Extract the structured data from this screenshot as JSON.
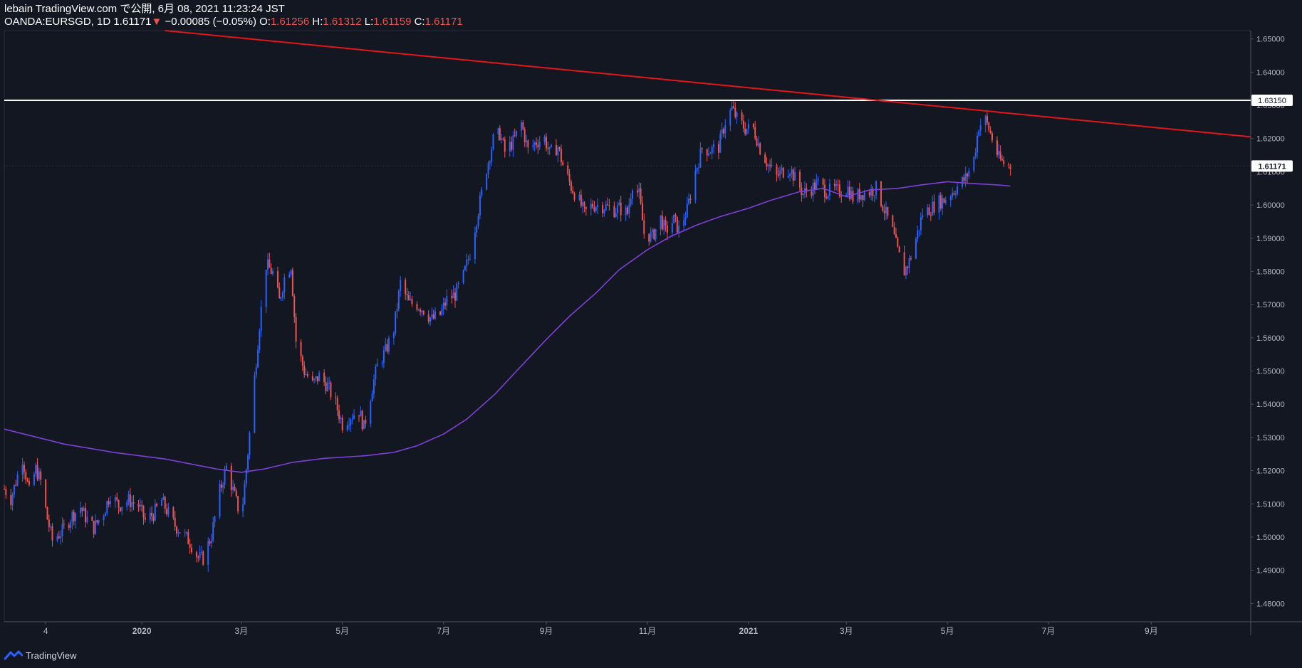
{
  "header": {
    "publish_line": "lebain TradingView.com で公開, 6月 08, 2021 11:23:24 JST",
    "symbol": "OANDA:EURSGD, 1D",
    "last": "1.61171",
    "change_arrow": "▼",
    "change": "−0.00085 (−0.05%)",
    "o_label": "O:",
    "o_value": "1.61256",
    "h_label": "H:",
    "h_value": "1.61312",
    "l_label": "L:",
    "l_value": "1.61159",
    "c_label": "C:",
    "c_value": "1.61171"
  },
  "footer": {
    "brand": "TradingView",
    "logo_icon": "tradingview-logo-icon"
  },
  "colors": {
    "background": "#131722",
    "up": "#2962ff",
    "down": "#ef5350",
    "ma": "#7e3fd6",
    "trendline": "#e3171a",
    "hline": "#ffffff",
    "axis_text": "#b2b5be"
  },
  "chart_data": {
    "type": "candlestick",
    "symbol": "OANDA:EURSGD",
    "interval": "1D",
    "ylim": [
      1.4745,
      1.6525
    ],
    "y_ticks": [
      "1.48000",
      "1.49000",
      "1.50000",
      "1.51000",
      "1.52000",
      "1.53000",
      "1.54000",
      "1.55000",
      "1.56000",
      "1.57000",
      "1.58000",
      "1.59000",
      "1.60000",
      "1.61000",
      "1.62000",
      "1.63000",
      "1.64000",
      "1.65000"
    ],
    "x_ticks": [
      {
        "date": "2019-11-04",
        "label": "4"
      },
      {
        "date": "2020-01-01",
        "label": "2020"
      },
      {
        "date": "2020-03-01",
        "label": "3月"
      },
      {
        "date": "2020-05-01",
        "label": "5月"
      },
      {
        "date": "2020-07-01",
        "label": "7月"
      },
      {
        "date": "2020-09-01",
        "label": "9月"
      },
      {
        "date": "2020-11-01",
        "label": "11月"
      },
      {
        "date": "2021-01-01",
        "label": "2021"
      },
      {
        "date": "2021-03-01",
        "label": "3月"
      },
      {
        "date": "2021-05-01",
        "label": "5月"
      },
      {
        "date": "2021-07-01",
        "label": "7月"
      },
      {
        "date": "2021-09-01",
        "label": "9月"
      }
    ],
    "x_range": [
      "2019-10-10",
      "2021-10-31"
    ],
    "horizontal_line": {
      "price": 1.6315,
      "label": "1.63150"
    },
    "last_price": {
      "price": 1.61171,
      "label": "1.61171"
    },
    "trendline": {
      "points": [
        {
          "date": "2020-01-15",
          "price": 1.6525
        },
        {
          "date": "2021-10-31",
          "price": 1.6205
        }
      ]
    },
    "moving_average": {
      "name": "",
      "points": [
        [
          "2019-10-10",
          1.5325
        ],
        [
          "2019-11-15",
          1.528
        ],
        [
          "2019-12-15",
          1.5255
        ],
        [
          "2020-01-15",
          1.5235
        ],
        [
          "2020-02-15",
          1.5205
        ],
        [
          "2020-03-01",
          1.5195
        ],
        [
          "2020-03-15",
          1.5205
        ],
        [
          "2020-04-01",
          1.5225
        ],
        [
          "2020-04-20",
          1.5237
        ],
        [
          "2020-05-15",
          1.5245
        ],
        [
          "2020-06-01",
          1.5255
        ],
        [
          "2020-06-15",
          1.5275
        ],
        [
          "2020-07-01",
          1.531
        ],
        [
          "2020-07-15",
          1.5355
        ],
        [
          "2020-08-01",
          1.543
        ],
        [
          "2020-08-15",
          1.5505
        ],
        [
          "2020-09-01",
          1.5595
        ],
        [
          "2020-09-15",
          1.5665
        ],
        [
          "2020-10-01",
          1.5735
        ],
        [
          "2020-10-15",
          1.5805
        ],
        [
          "2020-11-01",
          1.5865
        ],
        [
          "2020-11-15",
          1.5905
        ],
        [
          "2020-12-01",
          1.594
        ],
        [
          "2020-12-15",
          1.5965
        ],
        [
          "2021-01-01",
          1.599
        ],
        [
          "2021-01-15",
          1.6015
        ],
        [
          "2021-02-01",
          1.604
        ],
        [
          "2021-02-15",
          1.605
        ],
        [
          "2021-03-01",
          1.6025
        ],
        [
          "2021-03-15",
          1.6045
        ],
        [
          "2021-04-01",
          1.605
        ],
        [
          "2021-04-15",
          1.606
        ],
        [
          "2021-05-01",
          1.607
        ],
        [
          "2021-05-15",
          1.6065
        ],
        [
          "2021-06-01",
          1.606
        ],
        [
          "2021-06-08",
          1.6057
        ]
      ]
    },
    "price_path": [
      [
        "2019-10-10",
        1.5145
      ],
      [
        "2019-10-14",
        1.5115
      ],
      [
        "2019-10-21",
        1.5238
      ],
      [
        "2019-10-25",
        1.5135
      ],
      [
        "2019-10-29",
        1.5205
      ],
      [
        "2019-11-01",
        1.5168
      ],
      [
        "2019-11-05",
        1.5055
      ],
      [
        "2019-11-08",
        1.499
      ],
      [
        "2019-11-14",
        1.5018
      ],
      [
        "2019-11-20",
        1.5065
      ],
      [
        "2019-11-25",
        1.509
      ],
      [
        "2019-11-28",
        1.506
      ],
      [
        "2019-12-03",
        1.5028
      ],
      [
        "2019-12-09",
        1.5075
      ],
      [
        "2019-12-13",
        1.513
      ],
      [
        "2019-12-18",
        1.5095
      ],
      [
        "2019-12-24",
        1.511
      ],
      [
        "2019-12-30",
        1.5095
      ],
      [
        "2020-01-03",
        1.505
      ],
      [
        "2020-01-08",
        1.507
      ],
      [
        "2020-01-13",
        1.511
      ],
      [
        "2020-01-16",
        1.508
      ],
      [
        "2020-01-21",
        1.5035
      ],
      [
        "2020-01-25",
        1.5015
      ],
      [
        "2020-01-30",
        1.4985
      ],
      [
        "2020-02-04",
        1.4938
      ],
      [
        "2020-02-07",
        1.4935
      ],
      [
        "2020-02-12",
        1.5005
      ],
      [
        "2020-02-17",
        1.5138
      ],
      [
        "2020-02-21",
        1.521
      ],
      [
        "2020-02-25",
        1.514
      ],
      [
        "2020-03-01",
        1.5055
      ],
      [
        "2020-03-05",
        1.5255
      ],
      [
        "2020-03-09",
        1.548
      ],
      [
        "2020-03-12",
        1.564
      ],
      [
        "2020-03-16",
        1.582
      ],
      [
        "2020-03-20",
        1.5795
      ],
      [
        "2020-03-24",
        1.571
      ],
      [
        "2020-03-27",
        1.578
      ],
      [
        "2020-03-31",
        1.582
      ],
      [
        "2020-04-03",
        1.559
      ],
      [
        "2020-04-08",
        1.55
      ],
      [
        "2020-04-13",
        1.546
      ],
      [
        "2020-04-17",
        1.5485
      ],
      [
        "2020-04-22",
        1.5455
      ],
      [
        "2020-04-27",
        1.54
      ],
      [
        "2020-05-01",
        1.534
      ],
      [
        "2020-05-06",
        1.5365
      ],
      [
        "2020-05-11",
        1.538
      ],
      [
        "2020-05-14",
        1.533
      ],
      [
        "2020-05-19",
        1.545
      ],
      [
        "2020-05-22",
        1.5515
      ],
      [
        "2020-05-27",
        1.556
      ],
      [
        "2020-06-01",
        1.5625
      ],
      [
        "2020-06-05",
        1.5765
      ],
      [
        "2020-06-10",
        1.5705
      ],
      [
        "2020-06-15",
        1.57
      ],
      [
        "2020-06-19",
        1.5685
      ],
      [
        "2020-06-24",
        1.5655
      ],
      [
        "2020-06-29",
        1.567
      ],
      [
        "2020-07-03",
        1.5715
      ],
      [
        "2020-07-08",
        1.573
      ],
      [
        "2020-07-13",
        1.5785
      ],
      [
        "2020-07-17",
        1.5855
      ],
      [
        "2020-07-22",
        1.5985
      ],
      [
        "2020-07-27",
        1.611
      ],
      [
        "2020-07-31",
        1.6195
      ],
      [
        "2020-08-04",
        1.6215
      ],
      [
        "2020-08-07",
        1.616
      ],
      [
        "2020-08-12",
        1.619
      ],
      [
        "2020-08-17",
        1.6245
      ],
      [
        "2020-08-21",
        1.6165
      ],
      [
        "2020-08-26",
        1.619
      ],
      [
        "2020-08-31",
        1.62
      ],
      [
        "2020-09-03",
        1.6155
      ],
      [
        "2020-09-08",
        1.6175
      ],
      [
        "2020-09-11",
        1.612
      ],
      [
        "2020-09-16",
        1.6055
      ],
      [
        "2020-09-21",
        1.601
      ],
      [
        "2020-09-24",
        1.5975
      ],
      [
        "2020-09-29",
        1.6
      ],
      [
        "2020-10-02",
        1.6
      ],
      [
        "2020-10-07",
        1.5995
      ],
      [
        "2020-10-12",
        1.5985
      ],
      [
        "2020-10-15",
        1.599
      ],
      [
        "2020-10-20",
        1.5975
      ],
      [
        "2020-10-23",
        1.6065
      ],
      [
        "2020-10-27",
        1.603
      ],
      [
        "2020-10-30",
        1.5915
      ],
      [
        "2020-11-04",
        1.5905
      ],
      [
        "2020-11-09",
        1.596
      ],
      [
        "2020-11-12",
        1.592
      ],
      [
        "2020-11-17",
        1.5955
      ],
      [
        "2020-11-20",
        1.5925
      ],
      [
        "2020-11-25",
        1.5985
      ],
      [
        "2020-11-30",
        1.61
      ],
      [
        "2020-12-04",
        1.617
      ],
      [
        "2020-12-09",
        1.6165
      ],
      [
        "2020-12-14",
        1.6175
      ],
      [
        "2020-12-18",
        1.625
      ],
      [
        "2020-12-22",
        1.629
      ],
      [
        "2020-12-25",
        1.626
      ],
      [
        "2020-12-30",
        1.623
      ],
      [
        "2021-01-04",
        1.623
      ],
      [
        "2021-01-08",
        1.617
      ],
      [
        "2021-01-13",
        1.612
      ],
      [
        "2021-01-18",
        1.6085
      ],
      [
        "2021-01-21",
        1.61
      ],
      [
        "2021-01-26",
        1.611
      ],
      [
        "2021-01-29",
        1.608
      ],
      [
        "2021-02-03",
        1.6035
      ],
      [
        "2021-02-08",
        1.605
      ],
      [
        "2021-02-12",
        1.6065
      ],
      [
        "2021-02-17",
        1.604
      ],
      [
        "2021-02-22",
        1.6045
      ],
      [
        "2021-02-25",
        1.604
      ],
      [
        "2021-03-02",
        1.605
      ],
      [
        "2021-03-05",
        1.602
      ],
      [
        "2021-03-10",
        1.6035
      ],
      [
        "2021-03-15",
        1.604
      ],
      [
        "2021-03-19",
        1.605
      ],
      [
        "2021-03-24",
        1.5985
      ],
      [
        "2021-03-29",
        1.592
      ],
      [
        "2021-04-01",
        1.586
      ],
      [
        "2021-04-05",
        1.58
      ],
      [
        "2021-04-08",
        1.583
      ],
      [
        "2021-04-13",
        1.5915
      ],
      [
        "2021-04-16",
        1.5975
      ],
      [
        "2021-04-21",
        1.599
      ],
      [
        "2021-04-26",
        1.601
      ],
      [
        "2021-04-29",
        1.6015
      ],
      [
        "2021-05-04",
        1.604
      ],
      [
        "2021-05-07",
        1.6055
      ],
      [
        "2021-05-12",
        1.608
      ],
      [
        "2021-05-17",
        1.614
      ],
      [
        "2021-05-20",
        1.624
      ],
      [
        "2021-05-24",
        1.6255
      ],
      [
        "2021-05-27",
        1.6215
      ],
      [
        "2021-06-01",
        1.614
      ],
      [
        "2021-06-04",
        1.6125
      ],
      [
        "2021-06-08",
        1.6117
      ]
    ]
  }
}
